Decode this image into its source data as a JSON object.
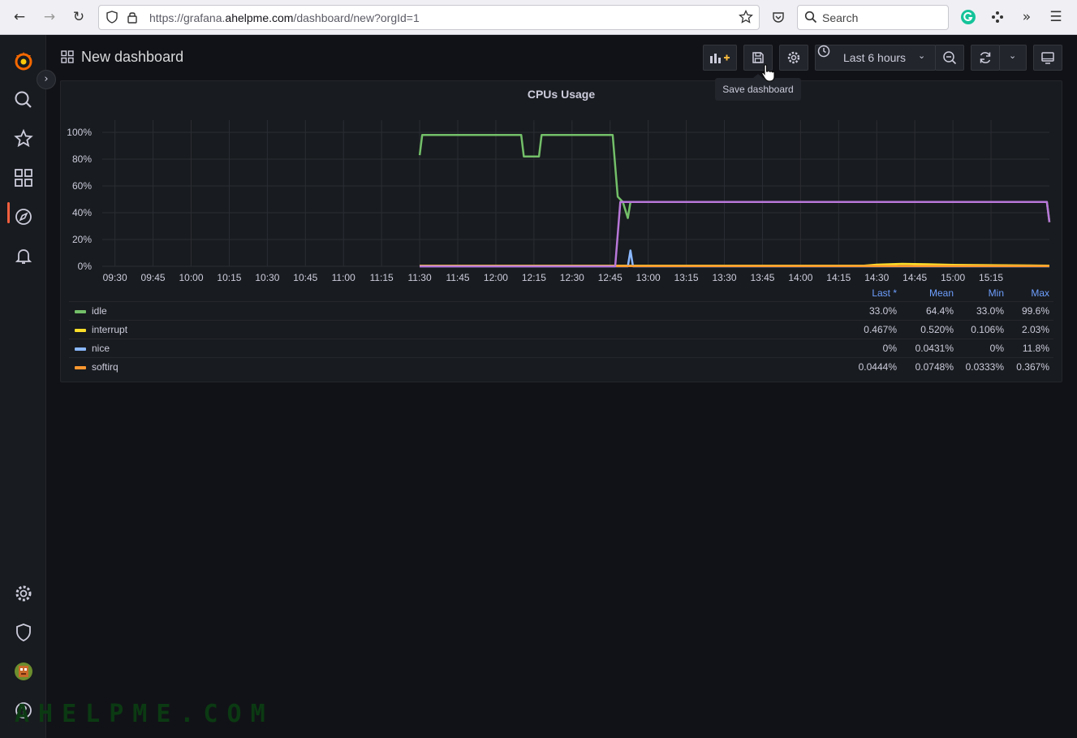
{
  "browser": {
    "url_prefix": "https://grafana.",
    "url_domain": "ahelpme.com",
    "url_suffix": "/dashboard/new?orgId=1",
    "search_placeholder": "Search"
  },
  "header": {
    "title": "New dashboard",
    "time_range": "Last 6 hours",
    "tooltip": "Save dashboard"
  },
  "panel": {
    "title": "CPUs Usage"
  },
  "chart_data": {
    "type": "line",
    "y_ticks": [
      "100%",
      "80%",
      "60%",
      "40%",
      "20%",
      "0%"
    ],
    "x_ticks": [
      "09:30",
      "09:45",
      "10:00",
      "10:15",
      "10:30",
      "10:45",
      "11:00",
      "11:15",
      "11:30",
      "11:45",
      "12:00",
      "12:15",
      "12:30",
      "12:45",
      "13:00",
      "13:15",
      "13:30",
      "13:45",
      "14:00",
      "14:15",
      "14:30",
      "14:45",
      "15:00",
      "15:15"
    ],
    "ylim": [
      0,
      100
    ],
    "x_range": [
      "09:25",
      "15:38"
    ],
    "series": [
      {
        "name": "idle",
        "color": "#73bf69",
        "points": [
          [
            "11:30",
            83
          ],
          [
            "11:31",
            98
          ],
          [
            "11:45",
            98
          ],
          [
            "12:10",
            98
          ],
          [
            "12:11",
            82
          ],
          [
            "12:17",
            82
          ],
          [
            "12:18",
            98
          ],
          [
            "12:46",
            98
          ],
          [
            "12:48",
            52
          ],
          [
            "12:50",
            48
          ],
          [
            "12:52",
            36
          ],
          [
            "12:53",
            48
          ],
          [
            "15:37",
            48
          ],
          [
            "15:38",
            33
          ]
        ]
      },
      {
        "name": "interrupt",
        "color": "#fade2a",
        "points": [
          [
            "11:30",
            0.5
          ],
          [
            "14:25",
            0.5
          ],
          [
            "14:30",
            1.2
          ],
          [
            "14:40",
            1.8
          ],
          [
            "14:50",
            1.5
          ],
          [
            "15:00",
            1
          ],
          [
            "15:38",
            0.5
          ]
        ]
      },
      {
        "name": "nice",
        "color": "#8ab8ff",
        "points": [
          [
            "11:30",
            0
          ],
          [
            "12:52",
            0
          ],
          [
            "12:53",
            11.8
          ],
          [
            "12:54",
            0
          ],
          [
            "15:38",
            0
          ]
        ]
      },
      {
        "name": "softirq",
        "color": "#ff9830",
        "points": [
          [
            "11:30",
            0.1
          ],
          [
            "15:38",
            0.1
          ]
        ]
      },
      {
        "name": "",
        "color": "#b877d9",
        "points": [
          [
            "11:30",
            0
          ],
          [
            "12:47",
            0
          ],
          [
            "12:49",
            48
          ],
          [
            "15:37",
            48
          ],
          [
            "15:38",
            33
          ]
        ]
      }
    ]
  },
  "legend": {
    "headers": [
      "Last *",
      "Mean",
      "Min",
      "Max"
    ],
    "rows": [
      {
        "name": "idle",
        "color": "#73bf69",
        "last": "33.0%",
        "mean": "64.4%",
        "min": "33.0%",
        "max": "99.6%"
      },
      {
        "name": "interrupt",
        "color": "#fade2a",
        "last": "0.467%",
        "mean": "0.520%",
        "min": "0.106%",
        "max": "2.03%"
      },
      {
        "name": "nice",
        "color": "#8ab8ff",
        "last": "0%",
        "mean": "0.0431%",
        "min": "0%",
        "max": "11.8%"
      },
      {
        "name": "softirq",
        "color": "#ff9830",
        "last": "0.0444%",
        "mean": "0.0748%",
        "min": "0.0333%",
        "max": "0.367%"
      }
    ]
  },
  "watermark": "AHELPME.COM"
}
